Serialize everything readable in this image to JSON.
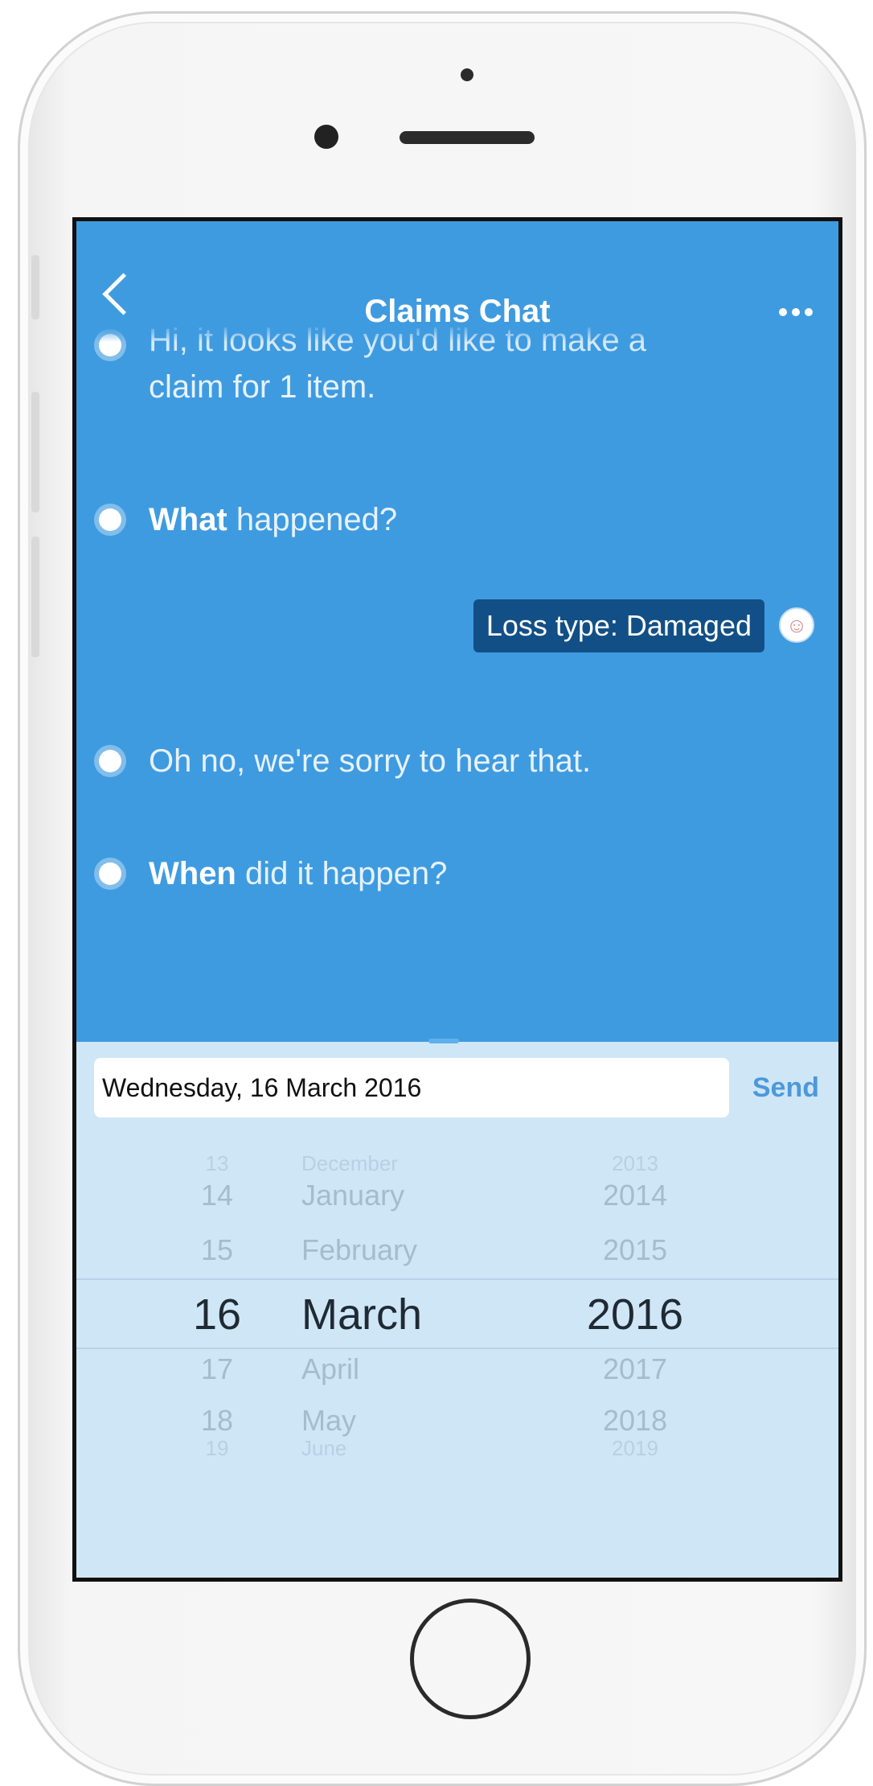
{
  "header": {
    "title": "Claims Chat"
  },
  "messages": [
    {
      "cutoff_text": "Hi, it looks like you'd like to make a",
      "text": "claim for 1 item."
    },
    {
      "bold": "What",
      "text": " happened?"
    },
    {
      "text": "Oh no, we're sorry to hear that."
    },
    {
      "bold": "When",
      "text": " did it happen?"
    }
  ],
  "reply": {
    "text": "Loss type: Damaged"
  },
  "input": {
    "value": "Wednesday, 16 March 2016",
    "send_label": "Send"
  },
  "picker": {
    "days": [
      "13",
      "14",
      "15",
      "16",
      "17",
      "18",
      "19"
    ],
    "months": [
      "December",
      "January",
      "February",
      "March",
      "April",
      "May",
      "June"
    ],
    "years": [
      "2013",
      "2014",
      "2015",
      "2016",
      "2017",
      "2018",
      "2019"
    ],
    "selected_index": 3
  },
  "colors": {
    "chat_bg": "#3f9be0",
    "reply_bg": "#124f86",
    "send": "#4c98db",
    "panel_bg": "#cfe6f7"
  }
}
